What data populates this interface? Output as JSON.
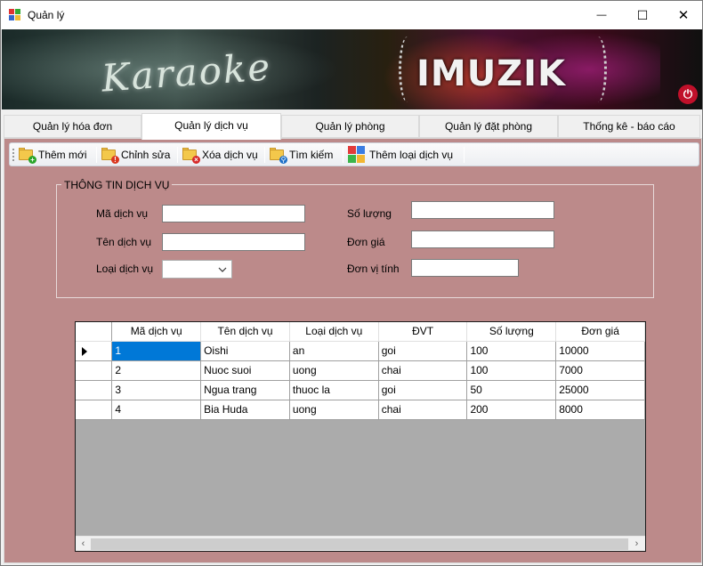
{
  "window": {
    "title": "Quản lý",
    "minimize_glyph": "—",
    "maximize_glyph": "☐",
    "close_glyph": "✕"
  },
  "banner": {
    "left_text": "Karaoke",
    "right_text": "IMUZIK",
    "power_glyph": "⏻"
  },
  "tabs": [
    {
      "label": "Quản lý hóa đơn"
    },
    {
      "label": "Quản lý dịch vụ"
    },
    {
      "label": "Quản lý phòng"
    },
    {
      "label": "Quản lý đặt phòng"
    },
    {
      "label": "Thống kê - báo cáo"
    }
  ],
  "toolbar": {
    "add": "Thêm mới",
    "edit": "Chỉnh sửa",
    "delete": "Xóa dịch vụ",
    "search": "Tìm kiếm",
    "add_type": "Thêm loại dịch vụ"
  },
  "form": {
    "group_title": "THÔNG TIN DỊCH VỤ",
    "ma_label": "Mã dịch vụ",
    "ma_value": "",
    "ten_label": "Tên dịch vụ",
    "ten_value": "",
    "loai_label": "Loại dịch vụ",
    "loai_value": "",
    "soluong_label": "Số lượng",
    "soluong_value": "",
    "dongia_label": "Đơn giá",
    "dongia_value": "",
    "dvt_label": "Đơn vị tính",
    "dvt_value": ""
  },
  "grid": {
    "columns": [
      "Mã dịch vụ",
      "Tên dịch vụ",
      "Loại dịch vụ",
      "ĐVT",
      "Số lượng",
      "Đơn giá"
    ],
    "rows": [
      [
        "1",
        "Oishi",
        "an",
        "goi",
        "100",
        "10000"
      ],
      [
        "2",
        "Nuoc suoi",
        "uong",
        "chai",
        "100",
        "7000"
      ],
      [
        "3",
        "Ngua trang",
        "thuoc la",
        "goi",
        "50",
        "25000"
      ],
      [
        "4",
        "Bia Huda",
        "uong",
        "chai",
        "200",
        "8000"
      ]
    ],
    "scroll_left": "‹",
    "scroll_right": "›"
  },
  "colors": {
    "page_background": "#bc8a8a",
    "selection": "#0078d7"
  }
}
